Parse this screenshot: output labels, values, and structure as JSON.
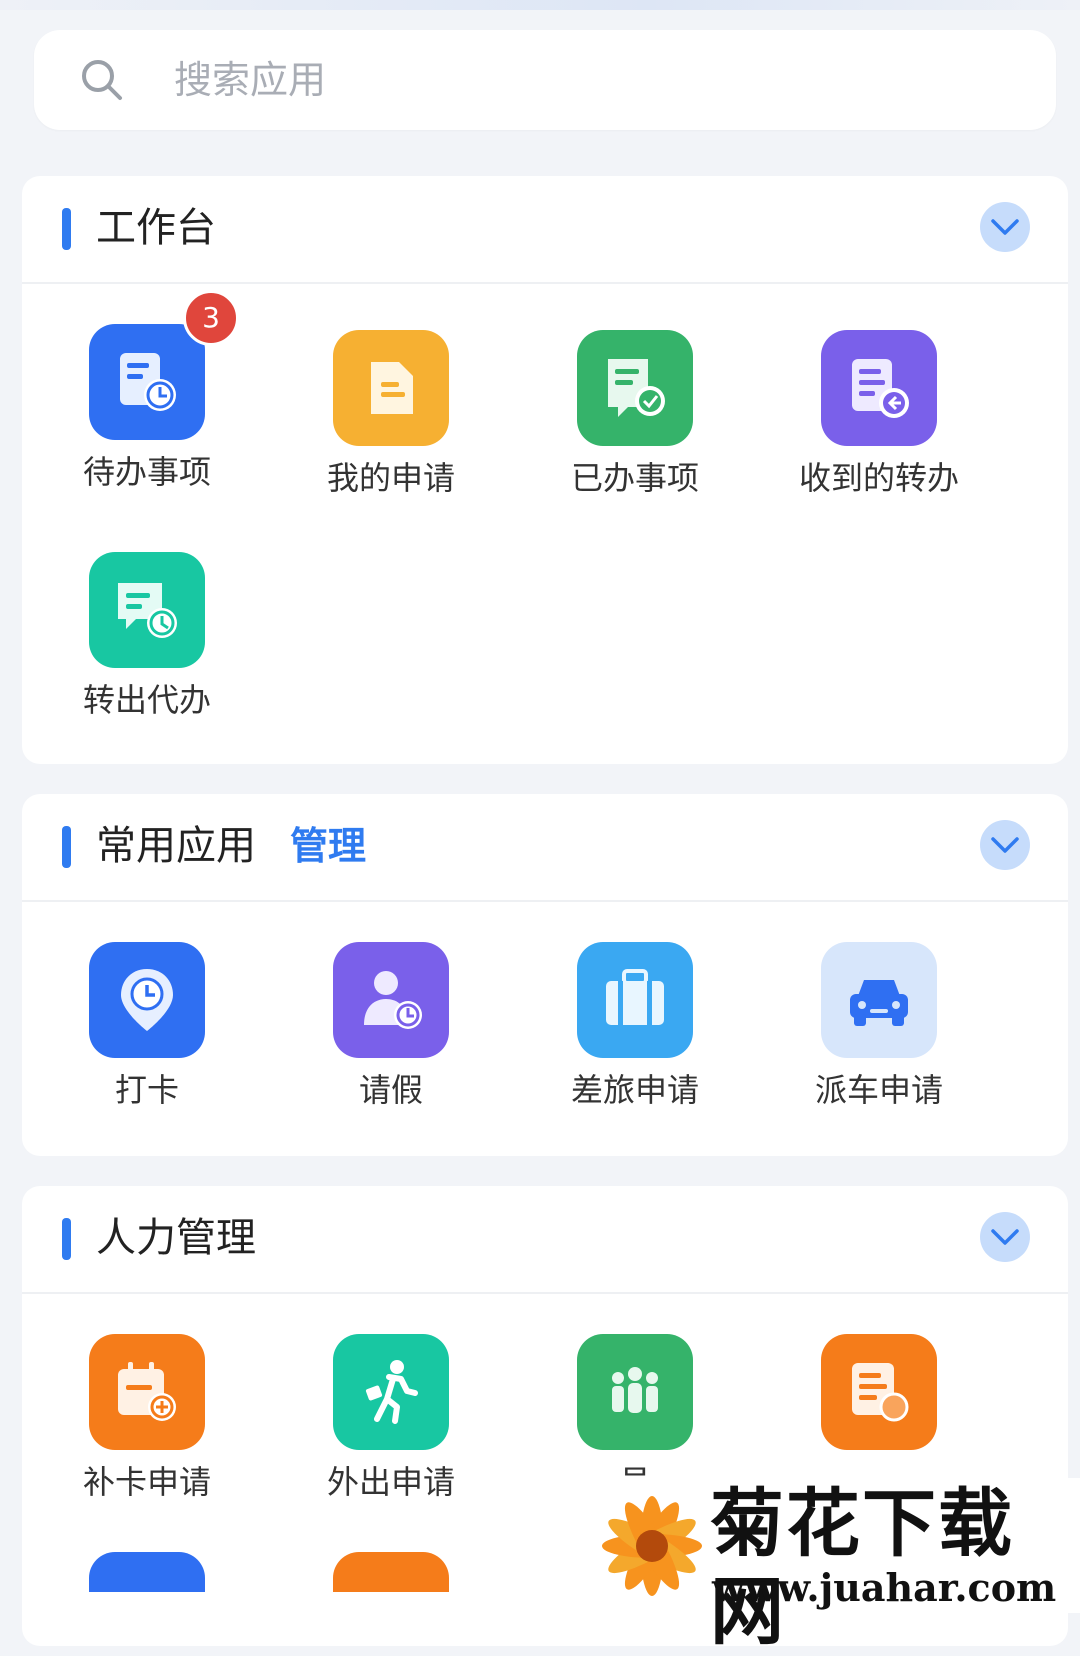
{
  "search": {
    "placeholder": "搜索应用"
  },
  "workbench": {
    "title": "工作台",
    "apps": [
      {
        "label": "待办事项",
        "badge": "3",
        "color": "#2f6ff2"
      },
      {
        "label": "我的申请",
        "color": "#f6b032"
      },
      {
        "label": "已办事项",
        "color": "#35b36a"
      },
      {
        "label": "收到的转办",
        "color": "#7a60ea"
      },
      {
        "label": "转出代办",
        "color": "#18c7a2"
      }
    ]
  },
  "common": {
    "title": "常用应用",
    "manage": "管理",
    "apps": [
      {
        "label": "打卡",
        "color": "#2f6ff2"
      },
      {
        "label": "请假",
        "color": "#7a60ea"
      },
      {
        "label": "差旅申请",
        "color": "#3aa8f2"
      },
      {
        "label": "派车申请",
        "color": "#d7e6fb"
      }
    ]
  },
  "hr": {
    "title": "人力管理",
    "apps": [
      {
        "label": "补卡申请",
        "color": "#f57c1a"
      },
      {
        "label": "外出申请",
        "color": "#18c7a2"
      },
      {
        "label": "员",
        "color": "#35b36a"
      },
      {
        "label": "",
        "color": "#f57c1a"
      }
    ]
  },
  "watermark": {
    "title": "菊花下载网",
    "url": "www.juahar.com"
  }
}
